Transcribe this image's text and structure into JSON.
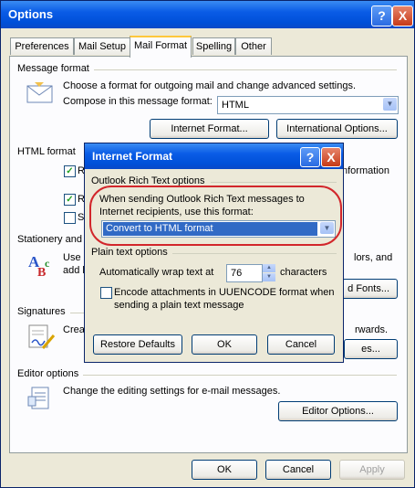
{
  "window": {
    "title": "Options",
    "help_btn": "?",
    "close_btn": "X"
  },
  "tabs": [
    "Preferences",
    "Mail Setup",
    "Mail Format",
    "Spelling",
    "Other"
  ],
  "message_format": {
    "heading": "Message format",
    "description": "Choose a format for outgoing mail and change advanced settings.",
    "compose_label": "Compose in this message format:",
    "compose_value": "HTML",
    "internet_format_button": "Internet Format...",
    "international_options_button": "International Options..."
  },
  "html_format": {
    "heading": "HTML format",
    "visible_fragments": [
      "R",
      "R",
      "S"
    ],
    "right_text_fragment": "nformation"
  },
  "stationery": {
    "heading": "Stationery and",
    "text1_fragment": "Use s",
    "text2_fragment": "add b",
    "right_text_fragment": "lors, and",
    "button_fragment": "d Fonts..."
  },
  "signatures": {
    "heading": "Signatures",
    "text_fragment": "Crea",
    "right_text_fragment": "rwards.",
    "button_fragment": "es..."
  },
  "editor_options": {
    "heading": "Editor options",
    "description": "Change the editing settings for e-mail messages.",
    "button": "Editor Options..."
  },
  "footer": {
    "ok": "OK",
    "cancel": "Cancel",
    "apply": "Apply"
  },
  "internet_format_dialog": {
    "title": "Internet Format",
    "help_btn": "?",
    "close_btn": "X",
    "rich_text_heading": "Outlook Rich Text options",
    "rich_text_label": "When sending Outlook Rich Text messages to Internet recipients, use this format:",
    "rich_text_value": "Convert to HTML format",
    "plain_text_heading": "Plain text options",
    "wrap_label": "Automatically wrap text at",
    "wrap_value": "76",
    "wrap_unit": "characters",
    "encode_label": "Encode attachments in UUENCODE format when sending a plain text message",
    "restore_button": "Restore Defaults",
    "ok_button": "OK",
    "cancel_button": "Cancel"
  },
  "colors": {
    "titlebar_blue": "#0a5ce6",
    "annotation_red": "#d2262b",
    "selected_highlight": "#316ac5"
  }
}
